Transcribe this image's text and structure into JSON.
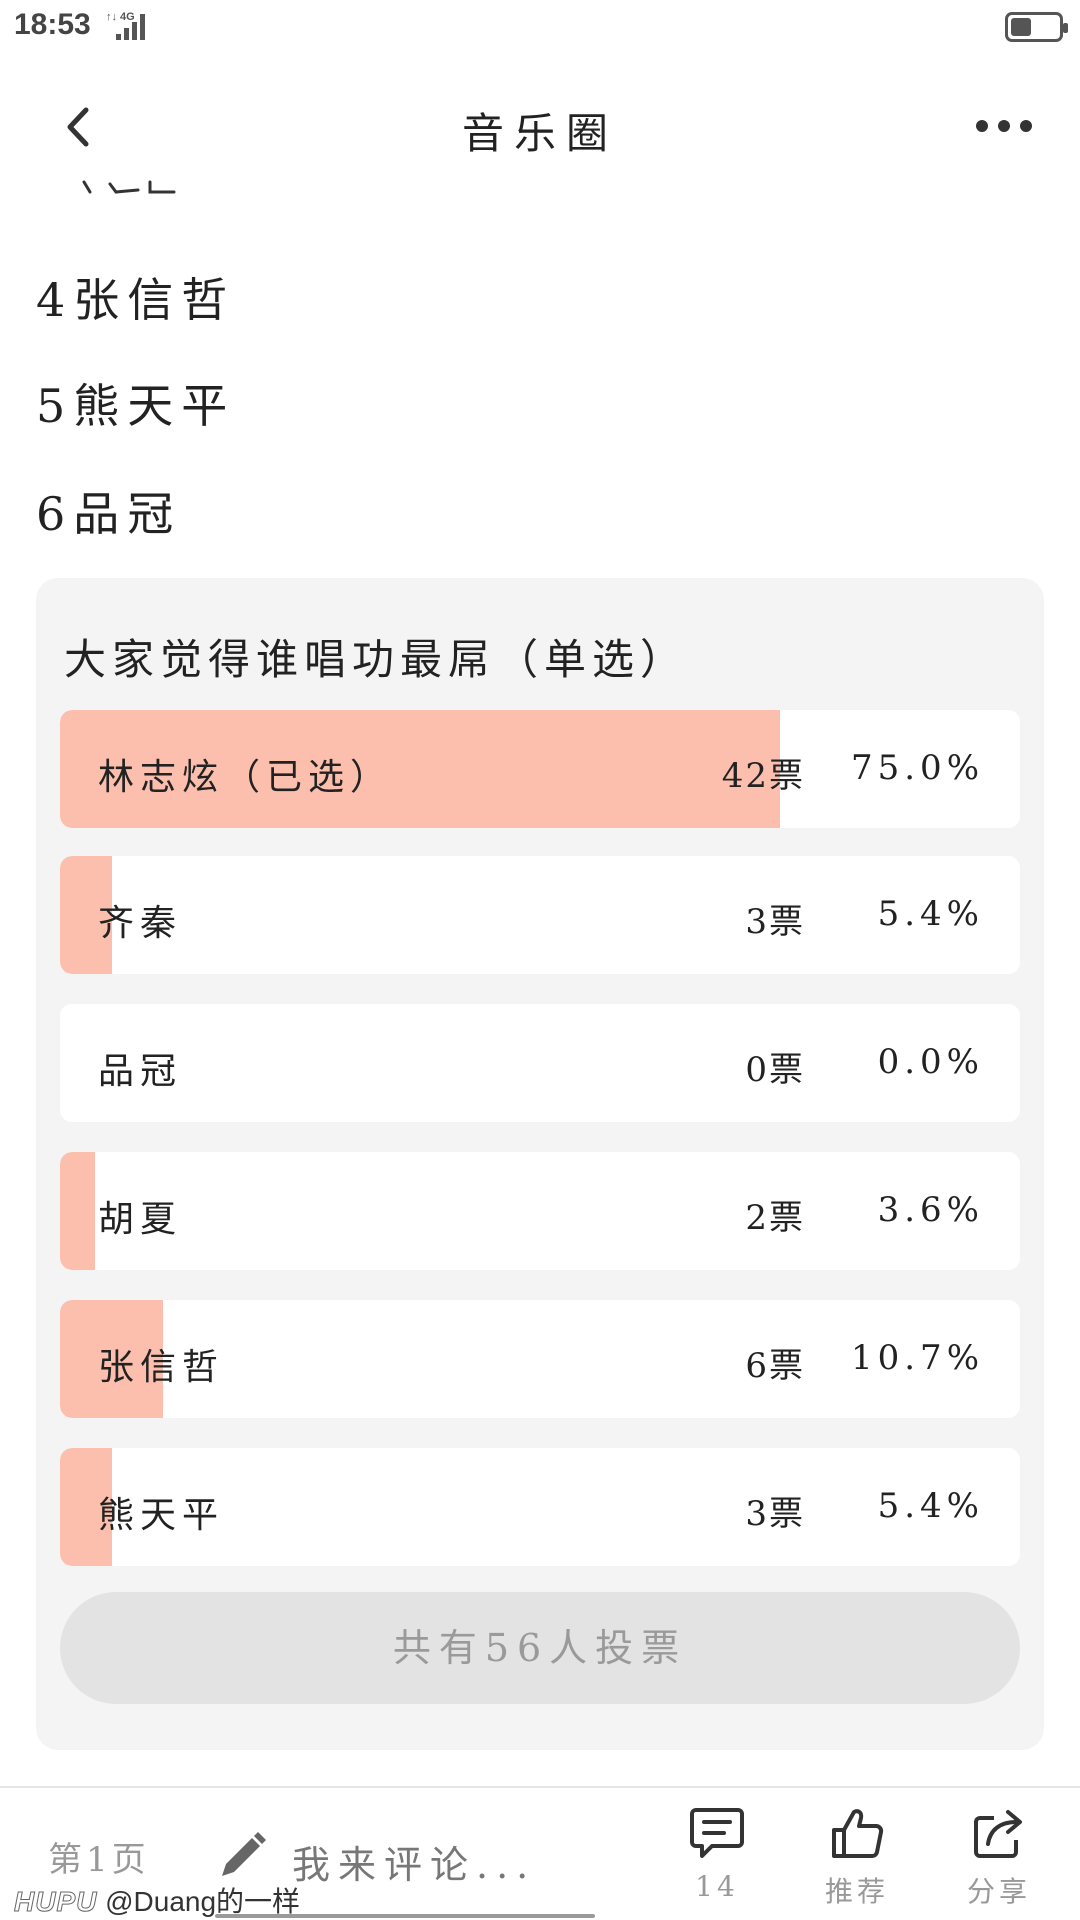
{
  "status_bar": {
    "time": "18:53",
    "network": "4G"
  },
  "nav": {
    "title": "音乐圈"
  },
  "article": {
    "items": [
      "4张信哲",
      "5熊天平",
      "6品冠"
    ]
  },
  "poll": {
    "title": "大家觉得谁唱功最屌（单选）",
    "options": [
      {
        "name": "林志炫（已选）",
        "votes": "42票",
        "percent": "75.0%",
        "fraction": 0.75,
        "selected": true
      },
      {
        "name": "齐秦",
        "votes": "3票",
        "percent": "5.4%",
        "fraction": 0.054,
        "selected": false
      },
      {
        "name": "品冠",
        "votes": "0票",
        "percent": "0.0%",
        "fraction": 0.0,
        "selected": false
      },
      {
        "name": "胡夏",
        "votes": "2票",
        "percent": "3.6%",
        "fraction": 0.036,
        "selected": false
      },
      {
        "name": "张信哲",
        "votes": "6票",
        "percent": "10.7%",
        "fraction": 0.107,
        "selected": false
      },
      {
        "name": "熊天平",
        "votes": "3票",
        "percent": "5.4%",
        "fraction": 0.054,
        "selected": false
      }
    ],
    "total_label": "共有56人投票",
    "bar_color": "#fcbfae"
  },
  "bottom_bar": {
    "page": "第1页",
    "comment_placeholder": "我来评论...",
    "comment_count": "14",
    "recommend_label": "推荐",
    "share_label": "分享"
  },
  "watermark": {
    "brand": "HUPU",
    "user": "@Duang的一样"
  }
}
